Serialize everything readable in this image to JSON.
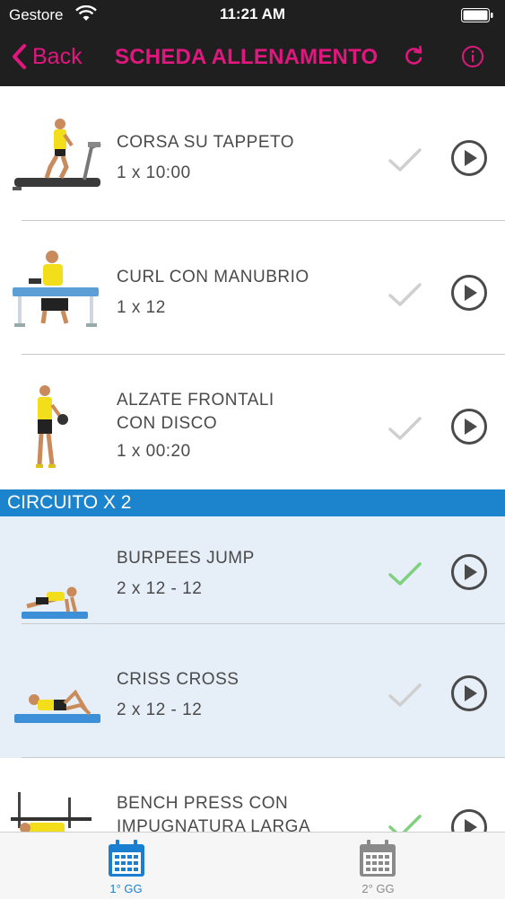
{
  "status_bar": {
    "carrier": "Gestore",
    "time": "11:21 AM"
  },
  "nav": {
    "back_label": "Back",
    "title": "SCHEDA ALLENAMENTO"
  },
  "exercises": [
    {
      "name": "CORSA SU TAPPETO",
      "reps": "1 x 10:00",
      "done": false
    },
    {
      "name": "CURL CON MANUBRIO",
      "reps": "1 x 12",
      "done": false
    },
    {
      "name_lines": [
        "ALZATE FRONTALI",
        "CON DISCO"
      ],
      "reps": "1 x 00:20",
      "done": false
    }
  ],
  "section": {
    "label": "CIRCUITO X 2"
  },
  "circuit_exercises": [
    {
      "name": "BURPEES JUMP",
      "reps": "2 x 12 - 12",
      "done": true
    },
    {
      "name": "CRISS CROSS",
      "reps": "2 x 12 - 12",
      "done": false
    }
  ],
  "partial_exercise": {
    "name_lines": [
      "BENCH PRESS CON",
      "IMPUGNATURA LARGA"
    ],
    "done": true
  },
  "tabs": [
    {
      "label": "1° GG",
      "active": true
    },
    {
      "label": "2° GG",
      "active": false
    }
  ],
  "colors": {
    "accent": "#e0177e",
    "section": "#1c84cc",
    "check_done": "#7fd07f",
    "check_todo": "#cfcfcf",
    "tab_active": "#1a7fd1",
    "tab_inactive": "#8a8a8a"
  }
}
